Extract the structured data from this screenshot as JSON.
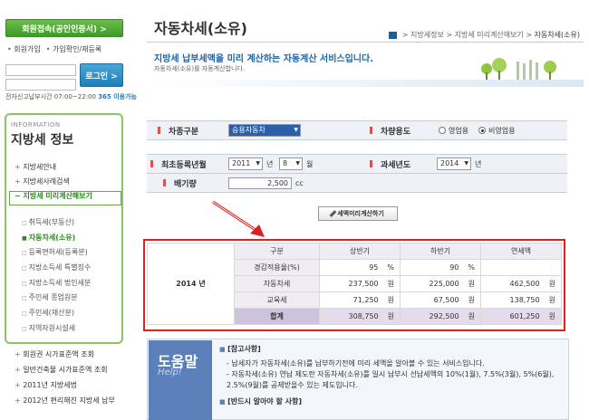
{
  "sidebar": {
    "login_button": "회원접속(공인인증서) >",
    "links": [
      "회원가입",
      "가입확인/재등록"
    ],
    "login_go": "로그인 >",
    "hours_prefix": "전자신고납부시간 07:00~22:00 ",
    "hours_suffix": "365 이용가능",
    "info_eng": "INFORMATION",
    "info_title": "지방세 정보",
    "nav": [
      "지방세안내",
      "지방세사례검색",
      "지방세 미리계산해보기"
    ],
    "sub_nav": [
      "취득세(부동산)",
      "자동차세(소유)",
      "등록면허세(등록분)",
      "지방소득세 특별징수",
      "지방소득세 법인세분",
      "주민세 종업원분",
      "주민세(재산분)",
      "지역자원시설세"
    ],
    "nav_bottom": [
      "회원권 시가표준액 조회",
      "일반건축물 시가표준액 조회",
      "2011년 지방세법",
      "2012년 편리해진 지방세 납부"
    ]
  },
  "page": {
    "title": "자동차세(소유)",
    "breadcrumb": [
      "지방세정보",
      "지방세 미리계산해보기",
      "자동차세(소유)"
    ],
    "headline": "지방세 납부세액을 미리 계산하는 자동계산 서비스입니다.",
    "subline": "자동차세(소유)를 자동계산합니다."
  },
  "form": {
    "car_type_label": "차종구분",
    "car_type_value": "승용자동차",
    "usage_label": "차량용도",
    "usage_options": [
      "영업용",
      "비영업용"
    ],
    "usage_selected": "비영업용",
    "reg_label": "최초등록년월",
    "reg_year": "2011",
    "year_unit": "년",
    "reg_month": "8",
    "month_unit": "월",
    "tax_year_label": "과세년도",
    "tax_year": "2014",
    "tax_year_unit": "년",
    "cc_label": "배기량",
    "cc_value": "2,500",
    "cc_unit": "cc",
    "calc_button": "세액미리계산하기"
  },
  "result": {
    "year": "2014 년",
    "headers": [
      "구분",
      "상반기",
      "하반기",
      "연세액"
    ],
    "rows": [
      {
        "label": "경감적용율(%)",
        "h1": "95",
        "h1_unit": "%",
        "h2": "90",
        "h2_unit": "%",
        "total": "",
        "total_unit": ""
      },
      {
        "label": "자동차세",
        "h1": "237,500",
        "h1_unit": "원",
        "h2": "225,000",
        "h2_unit": "원",
        "total": "462,500",
        "total_unit": "원"
      },
      {
        "label": "교육세",
        "h1": "71,250",
        "h1_unit": "원",
        "h2": "67,500",
        "h2_unit": "원",
        "total": "138,750",
        "total_unit": "원"
      },
      {
        "label": "합계",
        "h1": "308,750",
        "h1_unit": "원",
        "h2": "292,500",
        "h2_unit": "원",
        "total": "601,250",
        "total_unit": "원"
      }
    ]
  },
  "help": {
    "badge_ko": "도움말",
    "badge_en": "Help!",
    "heading": "[참고사항]",
    "items": [
      "- 납세자가 자동차세(소유)를 납부하기전에 미리 세액을 알아볼 수 있는 서비스입니다.",
      "- 자동차세(소유) 연납 제도란 자동차세(소유)를 일시 납부시 선납세액의 10%(1월), 7.5%(3월), 5%(6월), 2.5%(9월)를 공제받을수 있는 제도입니다."
    ],
    "heading2": "[반드시 알아야 할 사항]"
  }
}
